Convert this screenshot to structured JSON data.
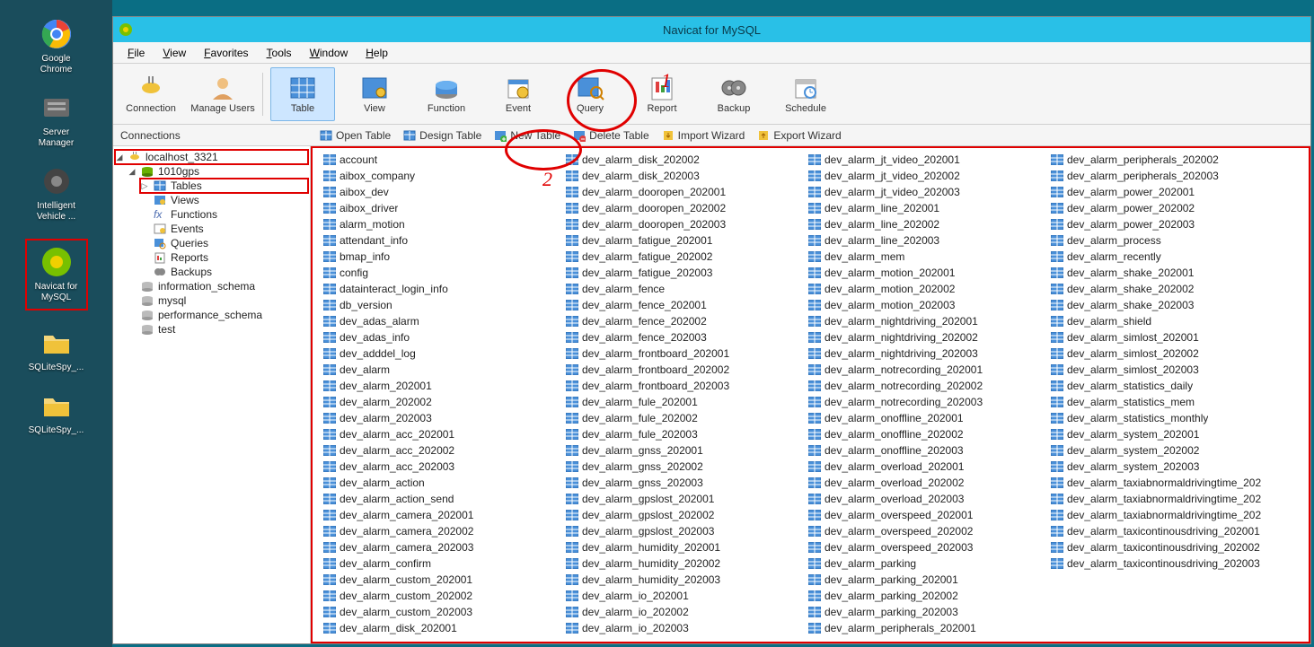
{
  "title": "Navicat for MySQL",
  "desktop_icons": [
    {
      "label": "Google Chrome",
      "kind": "chrome"
    },
    {
      "label": "Server Manager",
      "kind": "server"
    },
    {
      "label": "Intelligent Vehicle ...",
      "kind": "gear"
    },
    {
      "label": "Navicat for MySQL",
      "kind": "navicat",
      "highlight": true
    },
    {
      "label": "SQLiteSpy_...",
      "kind": "folder"
    },
    {
      "label": "SQLiteSpy_...",
      "kind": "folder"
    }
  ],
  "menubar": [
    "File",
    "View",
    "Favorites",
    "Tools",
    "Window",
    "Help"
  ],
  "toolbar": [
    {
      "label": "Connection",
      "icon": "plug"
    },
    {
      "label": "Manage Users",
      "icon": "user"
    },
    {
      "sep": true
    },
    {
      "label": "Table",
      "icon": "table",
      "active": true
    },
    {
      "label": "View",
      "icon": "view"
    },
    {
      "label": "Function",
      "icon": "function"
    },
    {
      "label": "Event",
      "icon": "event"
    },
    {
      "label": "Query",
      "icon": "query"
    },
    {
      "label": "Report",
      "icon": "report"
    },
    {
      "label": "Backup",
      "icon": "backup"
    },
    {
      "label": "Schedule",
      "icon": "schedule"
    }
  ],
  "subbar_label": "Connections",
  "subbar_actions": [
    {
      "label": "Open Table",
      "icon": "open"
    },
    {
      "label": "Design Table",
      "icon": "design"
    },
    {
      "label": "New Table",
      "icon": "new"
    },
    {
      "label": "Delete Table",
      "icon": "delete"
    },
    {
      "label": "Import Wizard",
      "icon": "import"
    },
    {
      "label": "Export Wizard",
      "icon": "export"
    }
  ],
  "tree": {
    "root": {
      "label": "localhost_3321",
      "icon": "conn",
      "expanded": true,
      "highlight": true,
      "children": [
        {
          "label": "1010gps",
          "icon": "db",
          "expanded": true,
          "children": [
            {
              "label": "Tables",
              "icon": "tables",
              "expanded": false,
              "highlight": true,
              "twisty": true
            },
            {
              "label": "Views",
              "icon": "views"
            },
            {
              "label": "Functions",
              "icon": "fx"
            },
            {
              "label": "Events",
              "icon": "events"
            },
            {
              "label": "Queries",
              "icon": "queries"
            },
            {
              "label": "Reports",
              "icon": "reports"
            },
            {
              "label": "Backups",
              "icon": "backups"
            }
          ]
        },
        {
          "label": "information_schema",
          "icon": "db-off"
        },
        {
          "label": "mysql",
          "icon": "db-off"
        },
        {
          "label": "performance_schema",
          "icon": "db-off"
        },
        {
          "label": "test",
          "icon": "db-off"
        }
      ]
    }
  },
  "tables_col1": [
    "account",
    "aibox_company",
    "aibox_dev",
    "aibox_driver",
    "alarm_motion",
    "attendant_info",
    "bmap_info",
    "config",
    "datainteract_login_info",
    "db_version",
    "dev_adas_alarm",
    "dev_adas_info",
    "dev_adddel_log",
    "dev_alarm",
    "dev_alarm_202001",
    "dev_alarm_202002",
    "dev_alarm_202003",
    "dev_alarm_acc_202001",
    "dev_alarm_acc_202002",
    "dev_alarm_acc_202003",
    "dev_alarm_action",
    "dev_alarm_action_send",
    "dev_alarm_camera_202001",
    "dev_alarm_camera_202002",
    "dev_alarm_camera_202003",
    "dev_alarm_confirm",
    "dev_alarm_custom_202001",
    "dev_alarm_custom_202002",
    "dev_alarm_custom_202003"
  ],
  "tables_col2": [
    "dev_alarm_disk_202001",
    "dev_alarm_disk_202002",
    "dev_alarm_disk_202003",
    "dev_alarm_dooropen_202001",
    "dev_alarm_dooropen_202002",
    "dev_alarm_dooropen_202003",
    "dev_alarm_fatigue_202001",
    "dev_alarm_fatigue_202002",
    "dev_alarm_fatigue_202003",
    "dev_alarm_fence",
    "dev_alarm_fence_202001",
    "dev_alarm_fence_202002",
    "dev_alarm_fence_202003",
    "dev_alarm_frontboard_202001",
    "dev_alarm_frontboard_202002",
    "dev_alarm_frontboard_202003",
    "dev_alarm_fule_202001",
    "dev_alarm_fule_202002",
    "dev_alarm_fule_202003",
    "dev_alarm_gnss_202001",
    "dev_alarm_gnss_202002",
    "dev_alarm_gnss_202003",
    "dev_alarm_gpslost_202001",
    "dev_alarm_gpslost_202002",
    "dev_alarm_gpslost_202003",
    "dev_alarm_humidity_202001",
    "dev_alarm_humidity_202002",
    "dev_alarm_humidity_202003",
    "dev_alarm_io_202001"
  ],
  "tables_col3": [
    "dev_alarm_io_202002",
    "dev_alarm_io_202003",
    "dev_alarm_jt_video_202001",
    "dev_alarm_jt_video_202002",
    "dev_alarm_jt_video_202003",
    "dev_alarm_line_202001",
    "dev_alarm_line_202002",
    "dev_alarm_line_202003",
    "dev_alarm_mem",
    "dev_alarm_motion_202001",
    "dev_alarm_motion_202002",
    "dev_alarm_motion_202003",
    "dev_alarm_nightdriving_202001",
    "dev_alarm_nightdriving_202002",
    "dev_alarm_nightdriving_202003",
    "dev_alarm_notrecording_202001",
    "dev_alarm_notrecording_202002",
    "dev_alarm_notrecording_202003",
    "dev_alarm_onoffline_202001",
    "dev_alarm_onoffline_202002",
    "dev_alarm_onoffline_202003",
    "dev_alarm_overload_202001",
    "dev_alarm_overload_202002",
    "dev_alarm_overload_202003",
    "dev_alarm_overspeed_202001",
    "dev_alarm_overspeed_202002",
    "dev_alarm_overspeed_202003",
    "dev_alarm_parking",
    "dev_alarm_parking_202001"
  ],
  "tables_col4": [
    "dev_alarm_parking_202002",
    "dev_alarm_parking_202003",
    "dev_alarm_peripherals_202001",
    "dev_alarm_peripherals_202002",
    "dev_alarm_peripherals_202003",
    "dev_alarm_power_202001",
    "dev_alarm_power_202002",
    "dev_alarm_power_202003",
    "dev_alarm_process",
    "dev_alarm_recently",
    "dev_alarm_shake_202001",
    "dev_alarm_shake_202002",
    "dev_alarm_shake_202003",
    "dev_alarm_shield",
    "dev_alarm_simlost_202001",
    "dev_alarm_simlost_202002",
    "dev_alarm_simlost_202003",
    "dev_alarm_statistics_daily",
    "dev_alarm_statistics_mem",
    "dev_alarm_statistics_monthly",
    "dev_alarm_system_202001",
    "dev_alarm_system_202002",
    "dev_alarm_system_202003",
    "dev_alarm_taxiabnormaldrivingtime_202",
    "dev_alarm_taxiabnormaldrivingtime_202",
    "dev_alarm_taxiabnormaldrivingtime_202",
    "dev_alarm_taxicontinousdriving_202001",
    "dev_alarm_taxicontinousdriving_202002",
    "dev_alarm_taxicontinousdriving_202003"
  ],
  "annotations": {
    "a1": "1",
    "a2": "2"
  }
}
